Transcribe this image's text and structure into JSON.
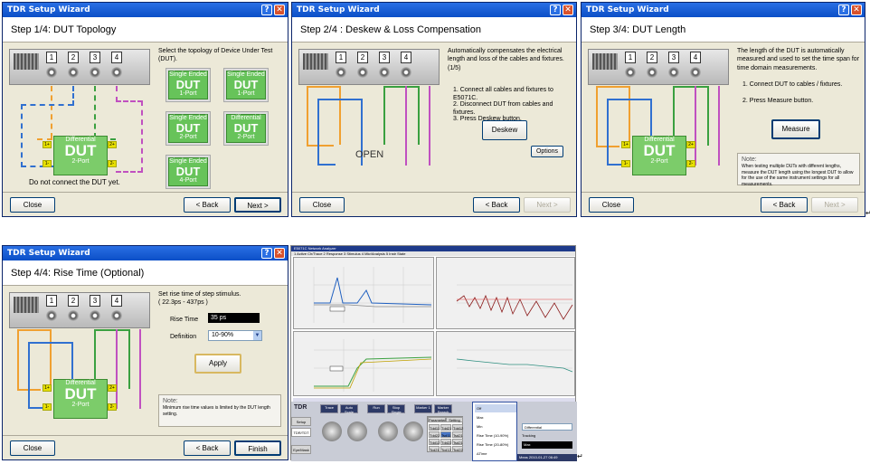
{
  "common": {
    "wizard_title": "TDR Setup Wizard",
    "help": "?",
    "close_x": "✕",
    "close": "Close",
    "back": "< Back",
    "next": "Next >",
    "finish": "Finish",
    "ports": [
      "1",
      "2",
      "3",
      "4"
    ],
    "pins": [
      "1+",
      "1-",
      "2+",
      "2-"
    ],
    "return_mark": "↵"
  },
  "w1": {
    "heading": "Step 1/4: DUT Topology",
    "text": "Select the topology of Device Under Test (DUT).",
    "dut_top": "Differential",
    "dut_mid": "DUT",
    "dut_bot": "2-Port",
    "warning": "Do not connect the DUT yet.",
    "options": [
      {
        "top": "Single Ended",
        "mid": "DUT",
        "bot": "1-Port"
      },
      {
        "top": "Single Ended",
        "mid": "DUT",
        "bot": "1-Port"
      },
      {
        "top": "Single Ended",
        "mid": "DUT",
        "bot": "2-Port"
      },
      {
        "top": "Differential",
        "mid": "DUT",
        "bot": "2-Port"
      },
      {
        "top": "Single Ended",
        "mid": "DUT",
        "bot": "4-Port"
      }
    ]
  },
  "w2": {
    "heading": "Step 2/4 : Deskew & Loss Compensation",
    "text": "Automatically compensates the electrical length and loss of the cables and fixtures. (1/5)",
    "step1": "1. Connect all cables and fixtures to E5071C.",
    "step2": "2. Disconnect DUT from cables and fixtures.",
    "step3": "3. Press Deskew button.",
    "open": "OPEN",
    "deskew": "Deskew",
    "options": "Options"
  },
  "w3": {
    "heading": "Step 3/4: DUT Length",
    "text": "The length of the DUT is automatically measured and used to set the time span for time domain measurements.",
    "step1": "1. Connect DUT to cables / fixtures.",
    "step2": "2. Press Measure button.",
    "measure": "Measure",
    "note_title": "Note:",
    "note": "When testing multiple DUTs with different lengths, measure the DUT length using the longest DUT to allow for the use of the same instrument settings for all measurements."
  },
  "w4": {
    "heading": "Step 4/4: Rise Time (Optional)",
    "text": "Set rise time of step stimulus.",
    "range": "( 22.3ps - 437ps )",
    "rise_label": "Rise Time",
    "rise_value": "35 ps",
    "def_label": "Definition",
    "def_value": "10-90%",
    "apply": "Apply",
    "note_title": "Note:",
    "note": "Minimum rise time values is limited by the DUT length setting."
  },
  "na": {
    "title": "E5071C Network Analyzer",
    "menu": "1 Active Ch/Trace   2 Response   3 Stimulus   4 Mkr/Analysis   5 Instr State",
    "tdr_logo": "TDR",
    "tabs": [
      "Setup",
      "TDR/TDT",
      "Eye/Mask"
    ],
    "soft": [
      "Trace",
      "Auto Scale",
      "Run",
      "Stop Single",
      "Marker 1",
      "Marker Search"
    ],
    "params": [
      "Tdd11",
      "Tdd21",
      "Tdd12",
      "Tdd22",
      "Tsd11",
      "Tsd21",
      "Tdd12",
      "Tdd22",
      "Tsd21",
      "Tcd21",
      "Tcd12",
      "Tcd22"
    ],
    "parameters_tab": "Parameters",
    "setting_tab": "Setting",
    "menu_items": [
      "Off",
      "Max",
      "Min",
      "Rise Time (10-90%)",
      "Rise Time (20-80%)",
      "ΔTime"
    ],
    "dd_value": "Differential",
    "tracking": "Tracking",
    "mag": "Max",
    "status": "Meas  2010-01-27 06:49"
  }
}
